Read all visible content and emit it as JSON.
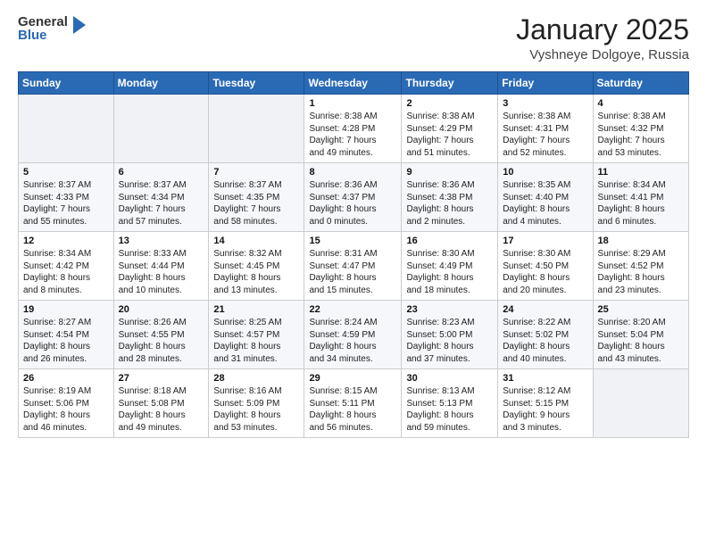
{
  "header": {
    "logo_general": "General",
    "logo_blue": "Blue",
    "title": "January 2025",
    "location": "Vyshneye Dolgoye, Russia"
  },
  "weekdays": [
    "Sunday",
    "Monday",
    "Tuesday",
    "Wednesday",
    "Thursday",
    "Friday",
    "Saturday"
  ],
  "weeks": [
    [
      {
        "day": "",
        "info": ""
      },
      {
        "day": "",
        "info": ""
      },
      {
        "day": "",
        "info": ""
      },
      {
        "day": "1",
        "info": "Sunrise: 8:38 AM\nSunset: 4:28 PM\nDaylight: 7 hours\nand 49 minutes."
      },
      {
        "day": "2",
        "info": "Sunrise: 8:38 AM\nSunset: 4:29 PM\nDaylight: 7 hours\nand 51 minutes."
      },
      {
        "day": "3",
        "info": "Sunrise: 8:38 AM\nSunset: 4:31 PM\nDaylight: 7 hours\nand 52 minutes."
      },
      {
        "day": "4",
        "info": "Sunrise: 8:38 AM\nSunset: 4:32 PM\nDaylight: 7 hours\nand 53 minutes."
      }
    ],
    [
      {
        "day": "5",
        "info": "Sunrise: 8:37 AM\nSunset: 4:33 PM\nDaylight: 7 hours\nand 55 minutes."
      },
      {
        "day": "6",
        "info": "Sunrise: 8:37 AM\nSunset: 4:34 PM\nDaylight: 7 hours\nand 57 minutes."
      },
      {
        "day": "7",
        "info": "Sunrise: 8:37 AM\nSunset: 4:35 PM\nDaylight: 7 hours\nand 58 minutes."
      },
      {
        "day": "8",
        "info": "Sunrise: 8:36 AM\nSunset: 4:37 PM\nDaylight: 8 hours\nand 0 minutes."
      },
      {
        "day": "9",
        "info": "Sunrise: 8:36 AM\nSunset: 4:38 PM\nDaylight: 8 hours\nand 2 minutes."
      },
      {
        "day": "10",
        "info": "Sunrise: 8:35 AM\nSunset: 4:40 PM\nDaylight: 8 hours\nand 4 minutes."
      },
      {
        "day": "11",
        "info": "Sunrise: 8:34 AM\nSunset: 4:41 PM\nDaylight: 8 hours\nand 6 minutes."
      }
    ],
    [
      {
        "day": "12",
        "info": "Sunrise: 8:34 AM\nSunset: 4:42 PM\nDaylight: 8 hours\nand 8 minutes."
      },
      {
        "day": "13",
        "info": "Sunrise: 8:33 AM\nSunset: 4:44 PM\nDaylight: 8 hours\nand 10 minutes."
      },
      {
        "day": "14",
        "info": "Sunrise: 8:32 AM\nSunset: 4:45 PM\nDaylight: 8 hours\nand 13 minutes."
      },
      {
        "day": "15",
        "info": "Sunrise: 8:31 AM\nSunset: 4:47 PM\nDaylight: 8 hours\nand 15 minutes."
      },
      {
        "day": "16",
        "info": "Sunrise: 8:30 AM\nSunset: 4:49 PM\nDaylight: 8 hours\nand 18 minutes."
      },
      {
        "day": "17",
        "info": "Sunrise: 8:30 AM\nSunset: 4:50 PM\nDaylight: 8 hours\nand 20 minutes."
      },
      {
        "day": "18",
        "info": "Sunrise: 8:29 AM\nSunset: 4:52 PM\nDaylight: 8 hours\nand 23 minutes."
      }
    ],
    [
      {
        "day": "19",
        "info": "Sunrise: 8:27 AM\nSunset: 4:54 PM\nDaylight: 8 hours\nand 26 minutes."
      },
      {
        "day": "20",
        "info": "Sunrise: 8:26 AM\nSunset: 4:55 PM\nDaylight: 8 hours\nand 28 minutes."
      },
      {
        "day": "21",
        "info": "Sunrise: 8:25 AM\nSunset: 4:57 PM\nDaylight: 8 hours\nand 31 minutes."
      },
      {
        "day": "22",
        "info": "Sunrise: 8:24 AM\nSunset: 4:59 PM\nDaylight: 8 hours\nand 34 minutes."
      },
      {
        "day": "23",
        "info": "Sunrise: 8:23 AM\nSunset: 5:00 PM\nDaylight: 8 hours\nand 37 minutes."
      },
      {
        "day": "24",
        "info": "Sunrise: 8:22 AM\nSunset: 5:02 PM\nDaylight: 8 hours\nand 40 minutes."
      },
      {
        "day": "25",
        "info": "Sunrise: 8:20 AM\nSunset: 5:04 PM\nDaylight: 8 hours\nand 43 minutes."
      }
    ],
    [
      {
        "day": "26",
        "info": "Sunrise: 8:19 AM\nSunset: 5:06 PM\nDaylight: 8 hours\nand 46 minutes."
      },
      {
        "day": "27",
        "info": "Sunrise: 8:18 AM\nSunset: 5:08 PM\nDaylight: 8 hours\nand 49 minutes."
      },
      {
        "day": "28",
        "info": "Sunrise: 8:16 AM\nSunset: 5:09 PM\nDaylight: 8 hours\nand 53 minutes."
      },
      {
        "day": "29",
        "info": "Sunrise: 8:15 AM\nSunset: 5:11 PM\nDaylight: 8 hours\nand 56 minutes."
      },
      {
        "day": "30",
        "info": "Sunrise: 8:13 AM\nSunset: 5:13 PM\nDaylight: 8 hours\nand 59 minutes."
      },
      {
        "day": "31",
        "info": "Sunrise: 8:12 AM\nSunset: 5:15 PM\nDaylight: 9 hours\nand 3 minutes."
      },
      {
        "day": "",
        "info": ""
      }
    ]
  ]
}
